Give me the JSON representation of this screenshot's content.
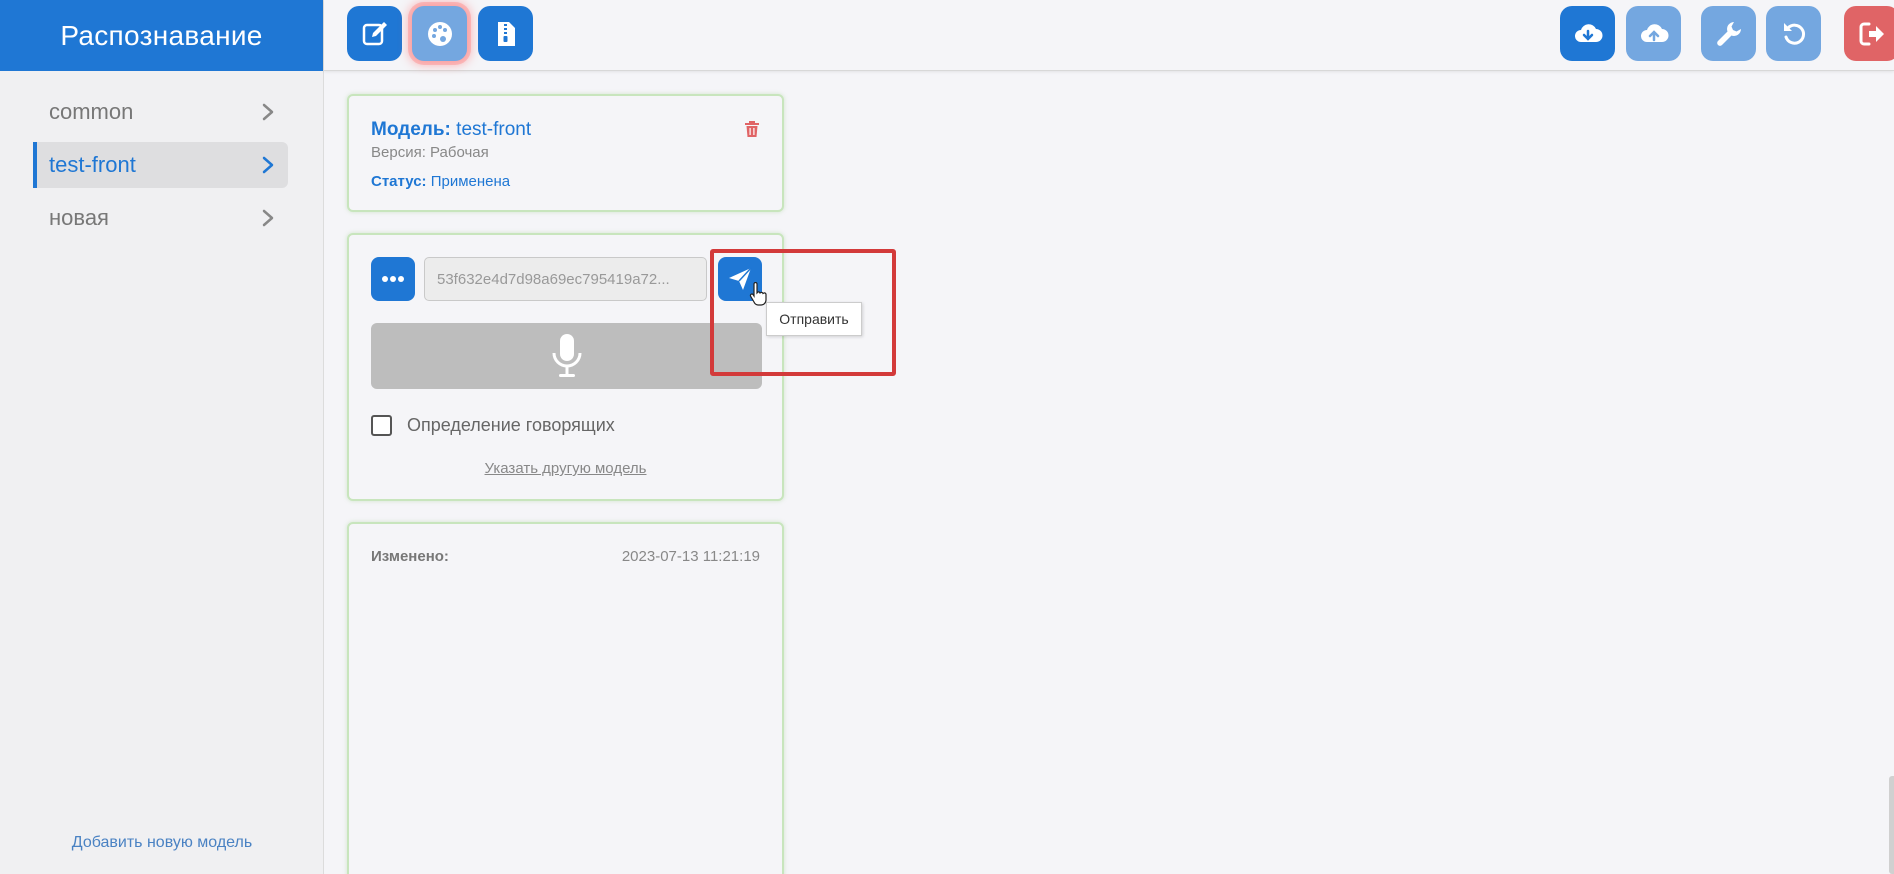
{
  "app": {
    "title": "Распознавание"
  },
  "sidebar": {
    "items": [
      {
        "label": "common",
        "active": false
      },
      {
        "label": "test-front",
        "active": true
      },
      {
        "label": "новая",
        "active": false
      }
    ],
    "add_model": "Добавить новую модель"
  },
  "toolbar": {
    "left_icons": [
      "edit-icon",
      "palette-icon",
      "file-zip-icon"
    ],
    "right_icons": [
      "cloud-download-icon",
      "cloud-upload-icon",
      "wrench-icon",
      "undo-icon",
      "logout-icon"
    ]
  },
  "model_card": {
    "title_label": "Модель:",
    "title_value": "test-front",
    "version": "Версия: Рабочая",
    "status_label": "Статус:",
    "status_value": "Применена"
  },
  "recognize_card": {
    "hash_value": "53f632e4d7d98a69ec795419a72...",
    "send_tooltip": "Отправить",
    "speaker_detection_label": "Определение говорящих",
    "speaker_detection_checked": false,
    "other_model_link": "Указать другую модель"
  },
  "info_card": {
    "changed_label": "Изменено:",
    "changed_value": "2023-07-13 11:21:19"
  },
  "colors": {
    "primary": "#1f77d4",
    "primary_light": "#74a7e0",
    "danger": "#e06466",
    "card_border": "#c8e5bd",
    "highlight": "#d33a3a"
  }
}
